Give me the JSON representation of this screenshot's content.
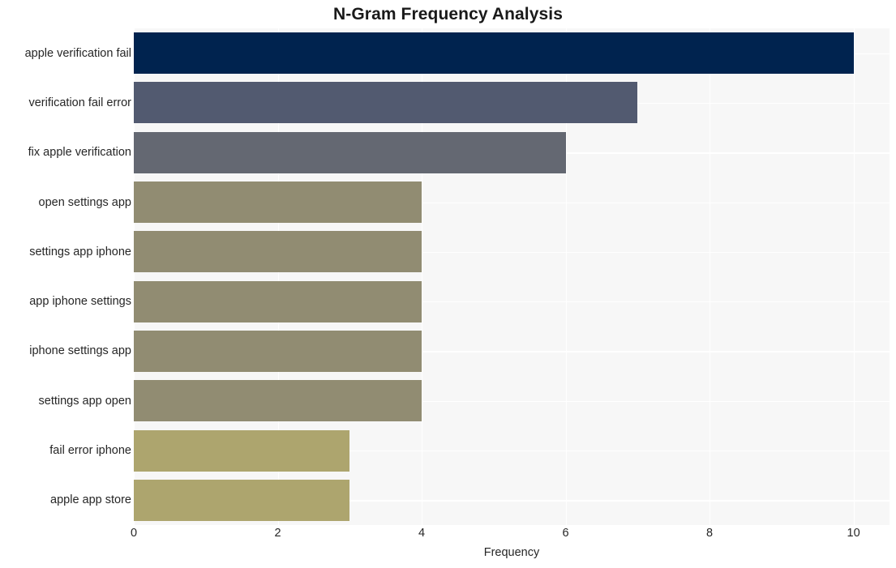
{
  "chart_data": {
    "type": "bar",
    "orientation": "horizontal",
    "title": "N-Gram Frequency Analysis",
    "xlabel": "Frequency",
    "ylabel": "",
    "xlim": [
      0,
      10.5
    ],
    "grid": true,
    "legend": false,
    "categories": [
      "apple verification fail",
      "verification fail error",
      "fix apple verification",
      "open settings app",
      "settings app iphone",
      "app iphone settings",
      "iphone settings app",
      "settings app open",
      "fail error iphone",
      "apple app store"
    ],
    "values": [
      10,
      7,
      6,
      4,
      4,
      4,
      4,
      4,
      3,
      3
    ],
    "bar_colors": [
      "#00234f",
      "#525a70",
      "#646872",
      "#918c72",
      "#918c72",
      "#918c72",
      "#918c72",
      "#918c72",
      "#ada56e",
      "#ada56e"
    ],
    "xticks": [
      0,
      2,
      4,
      6,
      8,
      10
    ],
    "xtick_labels": [
      "0",
      "2",
      "4",
      "6",
      "8",
      "10"
    ],
    "plot_background": "#f7f7f7",
    "grid_color": "#ffffff",
    "text_color": "#262626",
    "figure_background": "#ffffff"
  }
}
